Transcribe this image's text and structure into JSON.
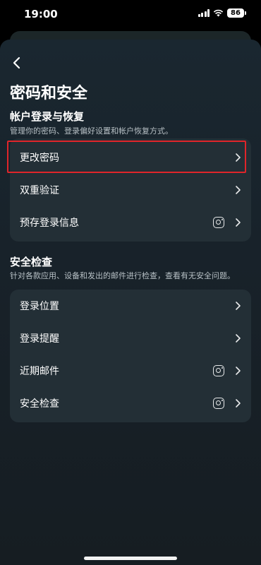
{
  "status_bar": {
    "time": "19:00",
    "battery": "86"
  },
  "header": {
    "title": "密码和安全"
  },
  "account_section": {
    "title": "帐户登录与恢复",
    "description": "管理你的密码、登录偏好设置和帐户恢复方式。",
    "items": [
      {
        "label": "更改密码",
        "icon": "chevron-right"
      },
      {
        "label": "双重验证",
        "icon": "chevron-right"
      },
      {
        "label": "预存登录信息",
        "icon": "instagram-icon"
      }
    ]
  },
  "security_section": {
    "title": "安全检查",
    "description": "针对各款应用、设备和发出的邮件进行检查，查看有无安全问题。",
    "items": [
      {
        "label": "登录位置",
        "icon": "chevron-right"
      },
      {
        "label": "登录提醒",
        "icon": "chevron-right"
      },
      {
        "label": "近期邮件",
        "icon": "instagram-icon"
      },
      {
        "label": "安全检查",
        "icon": "instagram-icon"
      }
    ]
  },
  "colors": {
    "highlight": "#e0252a",
    "card": "#232f36",
    "background": "#18222a"
  }
}
